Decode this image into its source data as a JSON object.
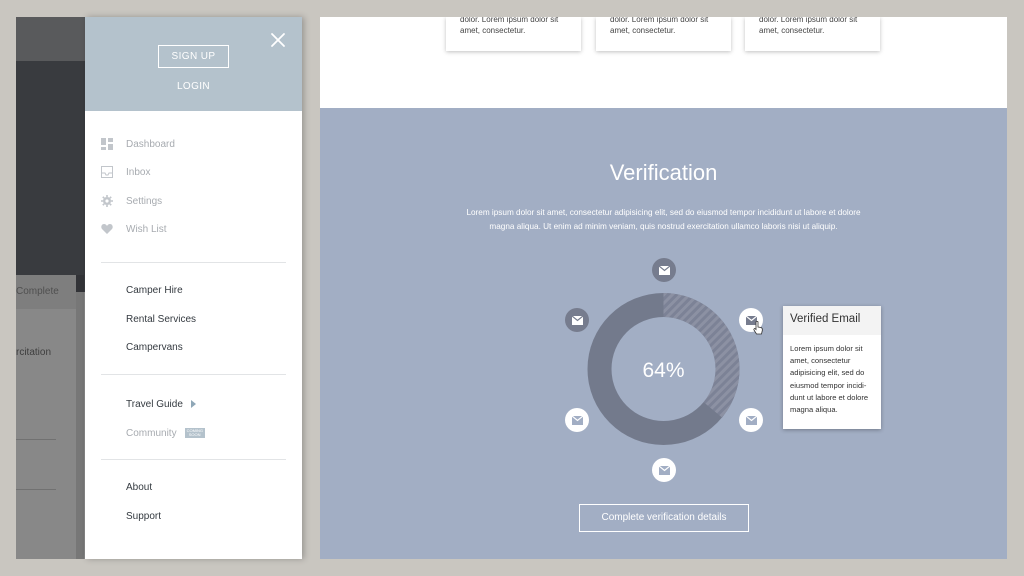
{
  "left_screen": {
    "tab_fragment": "Complete",
    "text_fragment": "rcitation"
  },
  "drawer": {
    "signup_label": "SIGN UP",
    "login_label": "LOGIN",
    "primary_items": [
      {
        "label": "Dashboard",
        "icon": "dashboard-icon"
      },
      {
        "label": "Inbox",
        "icon": "inbox-icon"
      },
      {
        "label": "Settings",
        "icon": "gear-icon"
      },
      {
        "label": "Wish List",
        "icon": "heart-icon"
      }
    ],
    "section2": [
      "Camper Hire",
      "Rental Services",
      "Campervans"
    ],
    "travel_guide": "Travel Guide",
    "community": "Community",
    "community_badge": [
      "COMING",
      "SOON"
    ],
    "section4": [
      "About",
      "Support"
    ]
  },
  "cards": [
    {
      "line1": "dolor. Lorem ipsum dolor sit",
      "line2": "amet, consectetur."
    },
    {
      "line1": "dolor. Lorem ipsum dolor sit",
      "line2": "amet, consectetur."
    },
    {
      "line1": "dolor. Lorem ipsum dolor sit",
      "line2": "amet, consectetur."
    }
  ],
  "verification": {
    "title": "Verification",
    "description_line1": "Lorem ipsum dolor sit amet, consectetur adipisicing elit, sed do eiusmod tempor incididunt ut labore et dolore",
    "description_line2": "magna aliqua. Ut enim ad minim veniam, quis nostrud exercitation ullamco laboris nisi ut aliquip.",
    "percent_text": "64%",
    "progress": 0.36,
    "tooltip_title": "Verified Email",
    "tooltip_lines": [
      "Lorem ipsum dolor sit",
      "amet, consectetur",
      "adipisicing elit, sed do",
      "eiusmod tempor incidi-",
      "dunt ut labore et dolore",
      "magna aliqua."
    ],
    "button_label": "Complete verification details"
  },
  "colors": {
    "panel_bg": "#a2aec4",
    "drawer_header": "#b4c2cc",
    "donut_ring": "#767c8e",
    "donut_center": "#a2aec4"
  }
}
